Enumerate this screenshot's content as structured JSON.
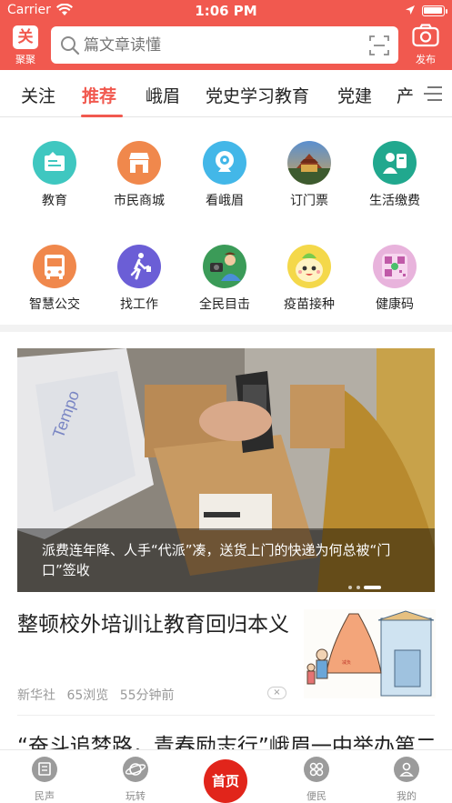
{
  "status_bar": {
    "carrier": "Carrier",
    "time": "1:06 PM",
    "battery_level": 1.0
  },
  "header": {
    "logo_label": "聚聚",
    "logo_glyph": "关",
    "search_placeholder": "篇文章读懂",
    "publish_label": "发布",
    "brand_color": "#f1594f"
  },
  "tabs": [
    {
      "label": "关注"
    },
    {
      "label": "推荐",
      "active": true
    },
    {
      "label": "峨眉"
    },
    {
      "label": "党史学习教育"
    },
    {
      "label": "党建"
    },
    {
      "label": "产"
    }
  ],
  "services": [
    {
      "label": "教育",
      "icon": "education-icon",
      "color": "#3fc7c0"
    },
    {
      "label": "市民商城",
      "icon": "store-icon",
      "color": "#f0884c"
    },
    {
      "label": "看峨眉",
      "icon": "camera-icon",
      "color": "#43b7e8"
    },
    {
      "label": "订门票",
      "icon": "temple-photo-icon",
      "color": "#3a6fb0"
    },
    {
      "label": "生活缴费",
      "icon": "payment-icon",
      "color": "#21a88e"
    },
    {
      "label": "智慧公交",
      "icon": "bus-icon",
      "color": "#f0884c"
    },
    {
      "label": "找工作",
      "icon": "walker-icon",
      "color": "#6b5ed6"
    },
    {
      "label": "全民目击",
      "icon": "reporter-icon",
      "color": "#3b9b58"
    },
    {
      "label": "疫苗接种",
      "icon": "mascot-icon",
      "color": "#f4d84a"
    },
    {
      "label": "健康码",
      "icon": "health-code-icon",
      "color": "#d884c4"
    }
  ],
  "hero": {
    "title": "派费连年降、人手“代派”凑，送货上门的快递为何总被“门口”签收",
    "slide_index": 3,
    "slide_count": 3
  },
  "article": {
    "title": "整顿校外培训让教育回归本义",
    "source": "新华社",
    "views": "65浏览",
    "time": "55分钟前",
    "close_label": "×"
  },
  "next_article": {
    "title": "“奋斗追梦路，青春励志行”峨眉一中举办第二"
  },
  "bottom_nav": {
    "items": [
      {
        "label": "民声",
        "icon": "people-voice-icon"
      },
      {
        "label": "玩转",
        "icon": "planet-icon"
      },
      {
        "label": "首页",
        "icon": "home-icon",
        "active": true
      },
      {
        "label": "便民",
        "icon": "services-icon"
      },
      {
        "label": "我的",
        "icon": "profile-icon"
      }
    ]
  }
}
